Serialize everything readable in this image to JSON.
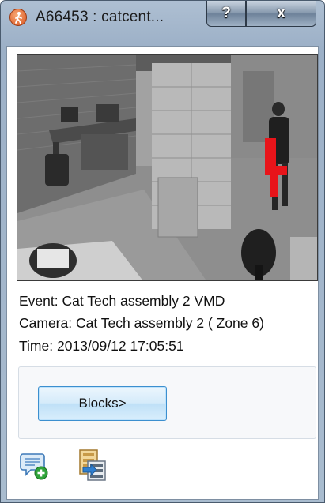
{
  "window": {
    "title": "A66453 : catcent...",
    "help_label": "?",
    "close_label": "x",
    "app_icon": "person-walking-icon"
  },
  "camera": {
    "image": "surveillance-camera-frame",
    "motion_marker_color": "#e8141a"
  },
  "event_info": {
    "event": "Event: Cat Tech assembly 2 VMD",
    "camera": "Camera: Cat Tech assembly 2 ( Zone 6)",
    "time": "Time: 2013/09/12 17:05:51"
  },
  "actions": {
    "blocks_label": "Blocks>"
  },
  "toolbar": {
    "icons": [
      "add-comment-icon",
      "blocks-list-icon"
    ]
  },
  "colors": {
    "titlebar": "#a9bccf",
    "button_border": "#3c8fcf",
    "button_fill": "#d5ebfa"
  }
}
